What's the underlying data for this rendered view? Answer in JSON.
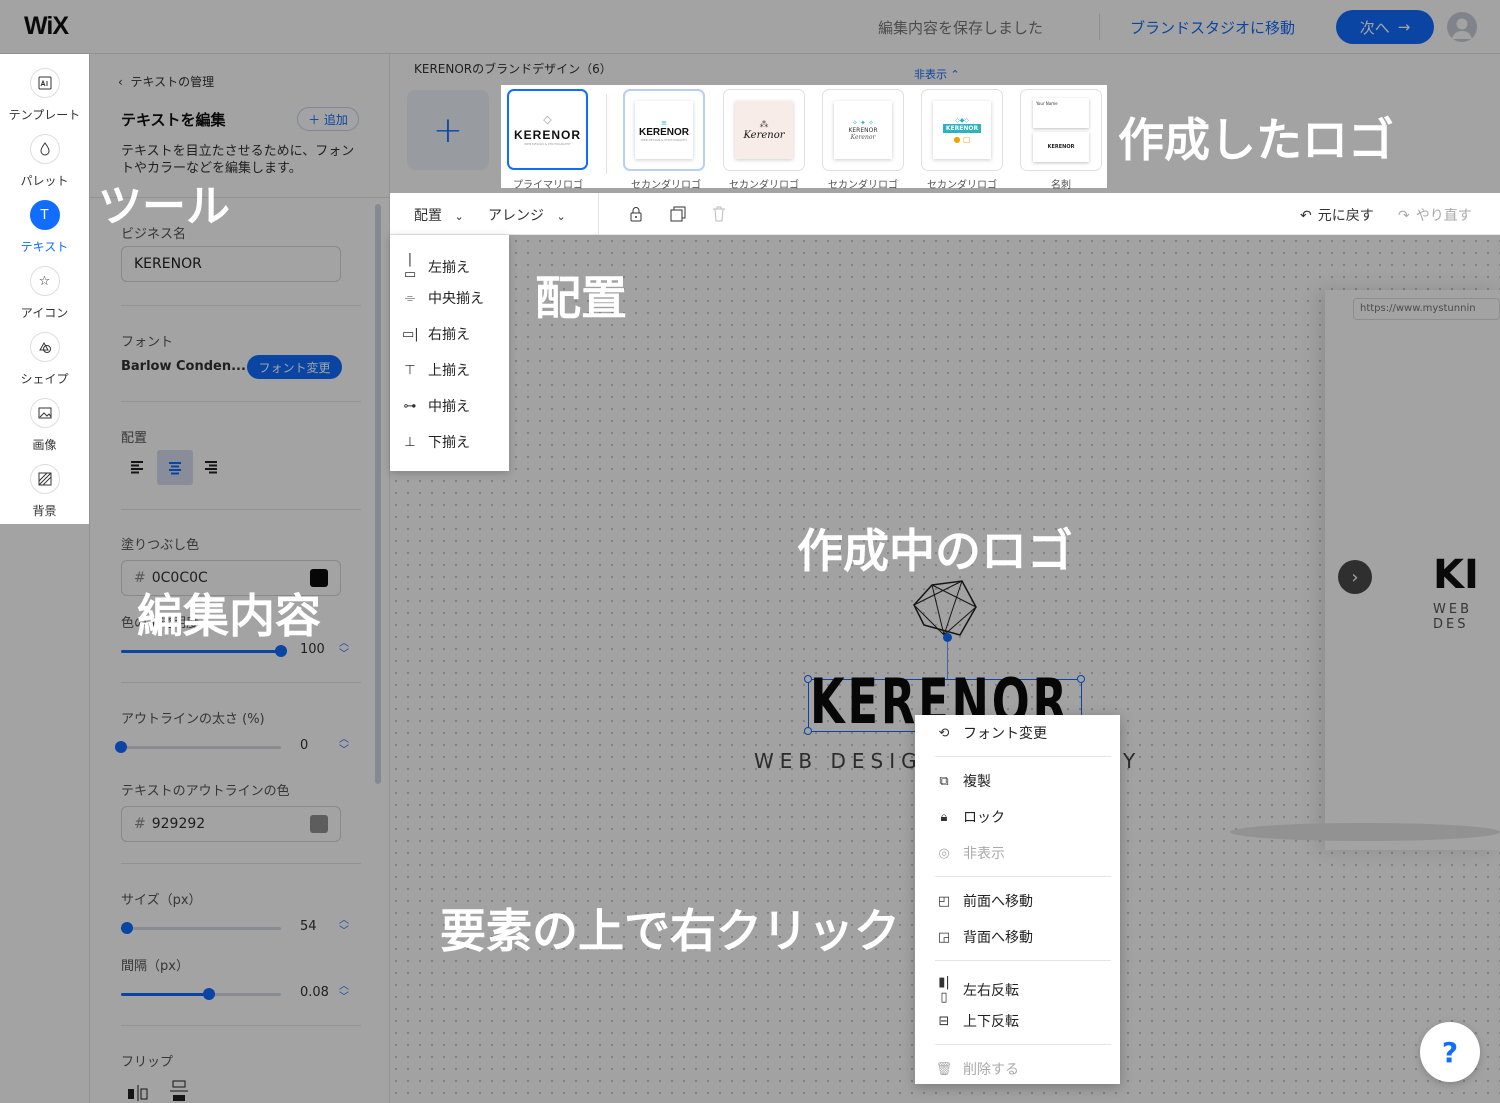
{
  "app": {
    "logo": "WiX"
  },
  "header": {
    "save_status": "編集内容を保存しました",
    "brand_studio_link": "ブランドスタジオに移動",
    "next_button": "次へ",
    "next_arrow": "→"
  },
  "tools": [
    {
      "label": "テンプレート",
      "icon": "template-icon"
    },
    {
      "label": "パレット",
      "icon": "palette-icon"
    },
    {
      "label": "テキスト",
      "icon": "text-icon",
      "active": true
    },
    {
      "label": "アイコン",
      "icon": "star-icon"
    },
    {
      "label": "シェイプ",
      "icon": "shape-icon"
    },
    {
      "label": "画像",
      "icon": "image-icon"
    },
    {
      "label": "背景",
      "icon": "background-icon"
    }
  ],
  "panel": {
    "back_link": "テキストの管理",
    "title": "テキストを編集",
    "add_button": "＋ 追加",
    "description": "テキストを目立たさせるために、フォントやカラーなどを編集します。",
    "business_name_label": "ビジネス名",
    "business_name_value": "KERENOR",
    "font_label": "フォント",
    "font_value": "Barlow Conden...",
    "font_change_button": "フォント変更",
    "alignment_label": "配置",
    "fill_color_label": "塗りつぶし色",
    "fill_color_value": "0C0C0C",
    "fill_color_hex": "#0C0C0C",
    "color_opacity_label": "色の不透明度",
    "opacity_value": "100",
    "opacity_fraction": 1.0,
    "outline_width_label": "アウトラインの太さ (%)",
    "outline_width_value": "0",
    "outline_fraction": 0.0,
    "outline_color_label": "テキストのアウトラインの色",
    "outline_color_value": "929292",
    "outline_color_hex": "#929292",
    "size_label": "サイズ（px）",
    "size_value": "54",
    "size_fraction": 0.04,
    "spacing_label": "間隔（px）",
    "spacing_value": "0.08",
    "spacing_fraction": 0.55,
    "flip_label": "フリップ",
    "hash": "#"
  },
  "logo_strip": {
    "title": "KERENORのブランドデザイン（6）",
    "hide_toggle": "非表示 ⌃",
    "add_symbol": "+",
    "cards": [
      {
        "caption": "プライマリロゴ",
        "mark": "KERENOR",
        "sub": "WEB DESIGN & PHOTOGRAPHY",
        "selected": true
      },
      {
        "caption": "セカンダリロゴ",
        "mark": "KERENOR",
        "sub": "WEB DESIGN & PHOTOGRAPHY"
      },
      {
        "caption": "セカンダリロゴ",
        "mark": "Kerenor",
        "sub": ""
      },
      {
        "caption": "セカンダリロゴ",
        "mark": "KERENOR",
        "sub": "Kerenor"
      },
      {
        "caption": "セカンダリロゴ",
        "mark": "KERENOR",
        "sub": ""
      },
      {
        "caption": "名刺",
        "mark": "KERENOR",
        "sub": "Your Name"
      }
    ]
  },
  "toolbar": {
    "align_menu": "配置",
    "arrange_menu": "アレンジ",
    "undo": "元に戻す",
    "redo": "やり直す"
  },
  "align_dropdown": [
    "左揃え",
    "中央揃え",
    "右揃え",
    "上揃え",
    "中揃え",
    "下揃え"
  ],
  "context_menu": [
    {
      "label": "フォント変更",
      "icon": "font-change-icon"
    },
    {
      "label": "複製",
      "icon": "duplicate-icon"
    },
    {
      "label": "ロック",
      "icon": "lock-icon"
    },
    {
      "label": "非表示",
      "icon": "eye-hide-icon",
      "disabled": true
    },
    {
      "label": "前面へ移動",
      "icon": "bring-forward-icon"
    },
    {
      "label": "背面へ移動",
      "icon": "send-backward-icon"
    },
    {
      "label": "左右反転",
      "icon": "flip-horizontal-icon"
    },
    {
      "label": "上下反転",
      "icon": "flip-vertical-icon"
    },
    {
      "label": "削除する",
      "icon": "trash-icon",
      "disabled": true
    }
  ],
  "canvas": {
    "logo_text": "KERENOR",
    "logo_tagline_left": "WEB DESIGN",
    "logo_tagline_right": "Y",
    "preview_url": "https://www.mystunnin",
    "preview_logo": "KI",
    "preview_tagline": "WEB DES"
  },
  "annotations": {
    "tools": "ツール",
    "created_logos": "作成したロゴ",
    "alignment": "配置",
    "logo_in_progress": "作成中のロゴ",
    "edit_content": "編集内容",
    "right_click": "要素の上で右クリック"
  },
  "help": "?"
}
